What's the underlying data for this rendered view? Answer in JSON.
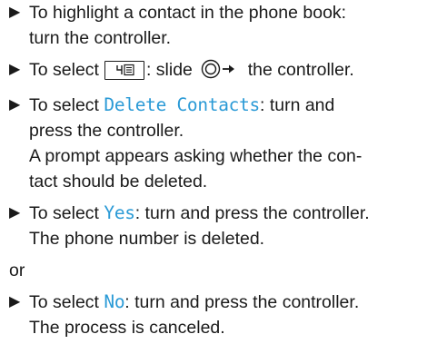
{
  "steps": [
    {
      "lines": [
        "To highlight a contact in the phone book:",
        "turn the controller."
      ]
    },
    {
      "pre": "To select",
      "post": ": slide",
      "post2": "the controller.",
      "icon": "phone-book-menu-icon",
      "control_icon": "controller-slide-right-icon"
    },
    {
      "pre": "To select",
      "highlight": "Delete Contacts",
      "post": ": turn and",
      "line2": "press the controller.",
      "line3": "A prompt appears asking whether the con-",
      "line4": "tact should be deleted."
    },
    {
      "pre": "To select",
      "highlight": "Yes",
      "post": ": turn and press the controller.",
      "line2": "The phone number is deleted."
    },
    {
      "pre": "To select",
      "highlight": "No",
      "post": ": turn and press the controller.",
      "line2": "The process is canceled."
    }
  ],
  "or_text": "or",
  "colors": {
    "highlight": "#2a9ad6",
    "text": "#1a1a1a"
  }
}
